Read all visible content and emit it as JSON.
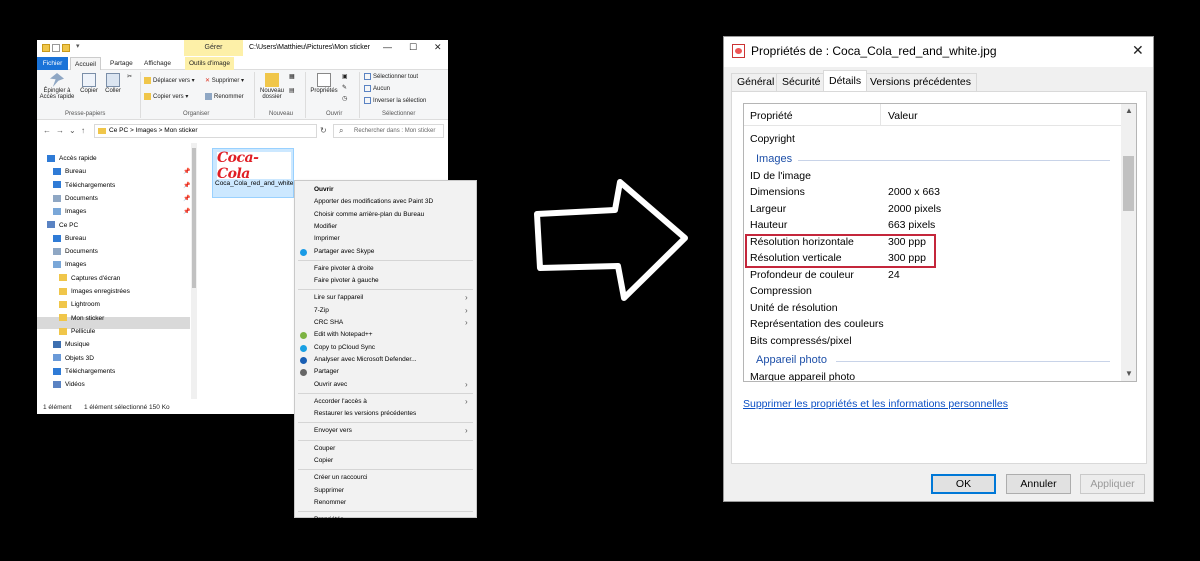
{
  "explorer": {
    "title_path": "C:\\Users\\Matthieu\\Pictures\\Mon sticker",
    "contextual_tab": "Gérer",
    "tabs": [
      "Fichier",
      "Accueil",
      "Partage",
      "Affichage",
      "Outils d'image"
    ],
    "ribbon": {
      "pin_quick": "Épingler à Accès rapide",
      "copy": "Copier",
      "paste": "Coller",
      "group_clipboard": "Presse-papiers",
      "move_to": "Déplacer vers",
      "copy_to": "Copier vers",
      "delete": "Supprimer",
      "rename": "Renommer",
      "group_organize": "Organiser",
      "new_folder": "Nouveau dossier",
      "group_new": "Nouveau",
      "properties": "Propriétés",
      "group_open": "Ouvrir",
      "select_all": "Sélectionner tout",
      "select_none": "Aucun",
      "invert_selection": "Inverser la sélection",
      "group_select": "Sélectionner"
    },
    "breadcrumb": "Ce PC  >  Images  >  Mon sticker",
    "search_placeholder": "Rechercher dans : Mon sticker",
    "nav": [
      {
        "label": "Accès rapide",
        "type": "star"
      },
      {
        "label": "Bureau",
        "type": "blue",
        "pinned": true
      },
      {
        "label": "Téléchargements",
        "type": "down",
        "pinned": true
      },
      {
        "label": "Documents",
        "type": "doc",
        "pinned": true
      },
      {
        "label": "Images",
        "type": "img",
        "pinned": true
      },
      {
        "label": "Ce PC",
        "type": "pc"
      },
      {
        "label": "Bureau",
        "type": "blue"
      },
      {
        "label": "Documents",
        "type": "doc"
      },
      {
        "label": "Images",
        "type": "img"
      },
      {
        "label": "Captures d'écran",
        "type": "folder"
      },
      {
        "label": "Images enregistrées",
        "type": "folder"
      },
      {
        "label": "Lightroom",
        "type": "folder"
      },
      {
        "label": "Mon sticker",
        "type": "folder"
      },
      {
        "label": "Pellicule",
        "type": "folder"
      },
      {
        "label": "Musique",
        "type": "music"
      },
      {
        "label": "Objets 3D",
        "type": "obj"
      },
      {
        "label": "Téléchargements",
        "type": "down"
      },
      {
        "label": "Vidéos",
        "type": "video"
      }
    ],
    "file": {
      "logo_text": "Coca-Cola",
      "name": "Coca_Cola_red_and_white.jpg"
    },
    "status_count": "1 élément",
    "status_selected": "1 élément sélectionné  150 Ko"
  },
  "context_menu": {
    "items": [
      {
        "label": "Ouvrir",
        "bold": true
      },
      {
        "label": "Apporter des modifications avec Paint 3D"
      },
      {
        "label": "Choisir comme arrière-plan du Bureau"
      },
      {
        "label": "Modifier"
      },
      {
        "label": "Imprimer"
      },
      {
        "label": "Partager avec Skype",
        "icon": "#1a9be6"
      },
      {
        "sep": true
      },
      {
        "label": "Faire pivoter à droite"
      },
      {
        "label": "Faire pivoter à gauche"
      },
      {
        "sep": true
      },
      {
        "label": "Lire sur l'appareil",
        "sub": true
      },
      {
        "label": "7-Zip",
        "sub": true
      },
      {
        "label": "CRC SHA",
        "sub": true
      },
      {
        "label": "Edit with Notepad++",
        "icon": "#7cb342"
      },
      {
        "label": "Copy to pCloud Sync",
        "icon": "#19a0e3"
      },
      {
        "label": "Analyser avec Microsoft Defender...",
        "icon": "#1a5fb4"
      },
      {
        "label": "Partager",
        "icon": "#666666"
      },
      {
        "label": "Ouvrir avec",
        "sub": true
      },
      {
        "sep": true
      },
      {
        "label": "Accorder l'accès à",
        "sub": true
      },
      {
        "label": "Restaurer les versions précédentes"
      },
      {
        "sep": true
      },
      {
        "label": "Envoyer vers",
        "sub": true
      },
      {
        "sep": true
      },
      {
        "label": "Couper"
      },
      {
        "label": "Copier"
      },
      {
        "sep": true
      },
      {
        "label": "Créer un raccourci"
      },
      {
        "label": "Supprimer"
      },
      {
        "label": "Renommer"
      },
      {
        "sep": true
      },
      {
        "label": "Propriétés"
      }
    ]
  },
  "properties": {
    "title": "Propriétés de : Coca_Cola_red_and_white.jpg",
    "tabs": [
      "Général",
      "Sécurité",
      "Détails",
      "Versions précédentes"
    ],
    "active_tab": "Détails",
    "col_property": "Propriété",
    "col_value": "Valeur",
    "rows": [
      {
        "label": "Copyright",
        "value": ""
      },
      {
        "section": "Images"
      },
      {
        "label": "ID de l'image",
        "value": ""
      },
      {
        "label": "Dimensions",
        "value": "2000 x 663"
      },
      {
        "label": "Largeur",
        "value": "2000 pixels"
      },
      {
        "label": "Hauteur",
        "value": "663 pixels"
      },
      {
        "label": "Résolution horizontale",
        "value": "300 ppp"
      },
      {
        "label": "Résolution verticale",
        "value": "300 ppp"
      },
      {
        "label": "Profondeur de couleur",
        "value": "24"
      },
      {
        "label": "Compression",
        "value": ""
      },
      {
        "label": "Unité de résolution",
        "value": ""
      },
      {
        "label": "Représentation des couleurs",
        "value": ""
      },
      {
        "label": "Bits compressés/pixel",
        "value": ""
      },
      {
        "section": "Appareil photo"
      },
      {
        "label": "Marque appareil photo",
        "value": ""
      }
    ],
    "remove_link": "Supprimer les propriétés et les informations personnelles",
    "ok": "OK",
    "cancel": "Annuler",
    "apply": "Appliquer"
  },
  "colors": {
    "accent": "#0078d7",
    "highlight_box": "#c4263b",
    "section_text": "#1d4fa8",
    "link": "#0b4fc4",
    "fichier_tab": "#1a73d8",
    "coke_red": "#e01e25"
  }
}
